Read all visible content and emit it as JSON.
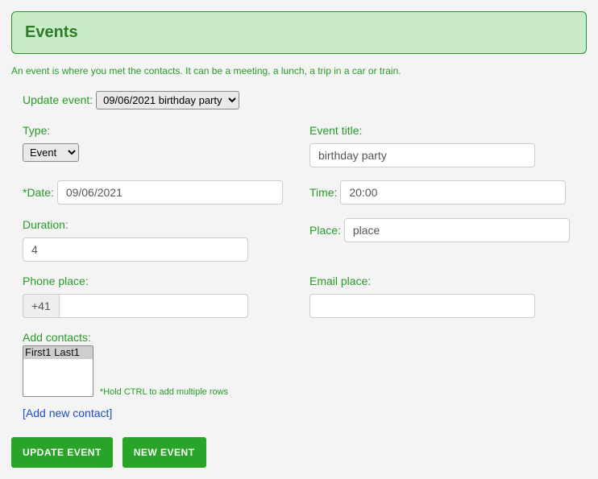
{
  "header": {
    "title": "Events"
  },
  "intro_text": "An event is where you met the contacts. It can be a meeting, a lunch, a trip in a car or train.",
  "update": {
    "label": "Update event:",
    "selected": "09/06/2021 birthday party"
  },
  "fields": {
    "type": {
      "label": "Type:",
      "selected": "Event"
    },
    "title": {
      "label": "Event title:",
      "value": "birthday party"
    },
    "date": {
      "label": "*Date:",
      "value": "09/06/2021"
    },
    "time": {
      "label": "Time:",
      "value": "20:00"
    },
    "duration": {
      "label": "Duration:",
      "value": "4"
    },
    "place": {
      "label": "Place:",
      "value": "place"
    },
    "phone_place": {
      "label": "Phone place:",
      "prefix": "+41",
      "value": ""
    },
    "email_place": {
      "label": "Email place:",
      "value": ""
    }
  },
  "contacts": {
    "label": "Add contacts:",
    "options": [
      "First1 Last1"
    ],
    "hint": "*Hold CTRL to add multiple rows",
    "add_link": "[Add new contact]"
  },
  "buttons": {
    "update": "UPDATE EVENT",
    "new": "NEW EVENT"
  }
}
